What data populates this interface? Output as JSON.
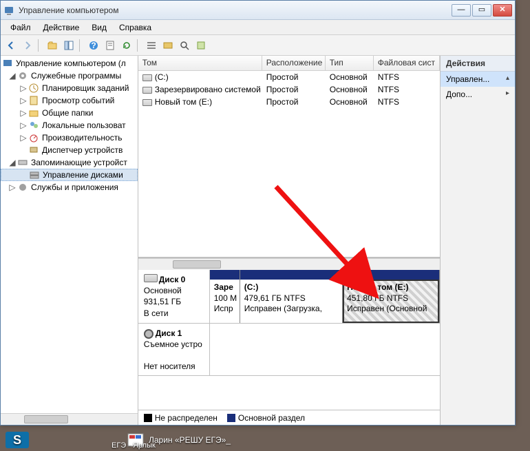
{
  "window": {
    "title": "Управление компьютером"
  },
  "menu": {
    "file": "Файл",
    "action": "Действие",
    "view": "Вид",
    "help": "Справка"
  },
  "tree": {
    "root": "Управление компьютером (л",
    "sys": "Служебные программы",
    "scheduler": "Планировщик заданий",
    "events": "Просмотр событий",
    "folders": "Общие папки",
    "users": "Локальные пользоват",
    "perf": "Производительность",
    "devmgr": "Диспетчер устройств",
    "storage": "Запоминающие устройст",
    "diskmgmt": "Управление дисками",
    "services": "Службы и приложения"
  },
  "columns": {
    "vol": "Том",
    "layout": "Расположение",
    "type": "Тип",
    "fs": "Файловая сист"
  },
  "volumes": [
    {
      "name": "(C:)",
      "layout": "Простой",
      "type": "Основной",
      "fs": "NTFS"
    },
    {
      "name": "Зарезервировано системой",
      "layout": "Простой",
      "type": "Основной",
      "fs": "NTFS"
    },
    {
      "name": "Новый том (E:)",
      "layout": "Простой",
      "type": "Основной",
      "fs": "NTFS"
    }
  ],
  "disk0": {
    "name": "Диск 0",
    "type": "Основной",
    "size": "931,51 ГБ",
    "status": "В сети"
  },
  "disk1": {
    "name": "Диск 1",
    "type": "Съемное устро",
    "status": "Нет носителя"
  },
  "parts": {
    "reserved": {
      "title": "Заре",
      "size": "100 М",
      "status": "Испр"
    },
    "c": {
      "title": "(C:)",
      "size": "479,61 ГБ NTFS",
      "status": "Исправен (Загрузка,"
    },
    "e": {
      "title": "Новый том  (E:)",
      "size": "451,80 ГБ NTFS",
      "status": "Исправен (Основной"
    }
  },
  "legend": {
    "unalloc": "Не распределен",
    "primary": "Основной раздел"
  },
  "actions": {
    "hdr": "Действия",
    "manage": "Управлен...",
    "more": "Допо..."
  },
  "taskbar": {
    "file1": "Ларин «РЕШУ ЕГЭ»_",
    "file2": "ЕГЭ - Ярлык"
  }
}
